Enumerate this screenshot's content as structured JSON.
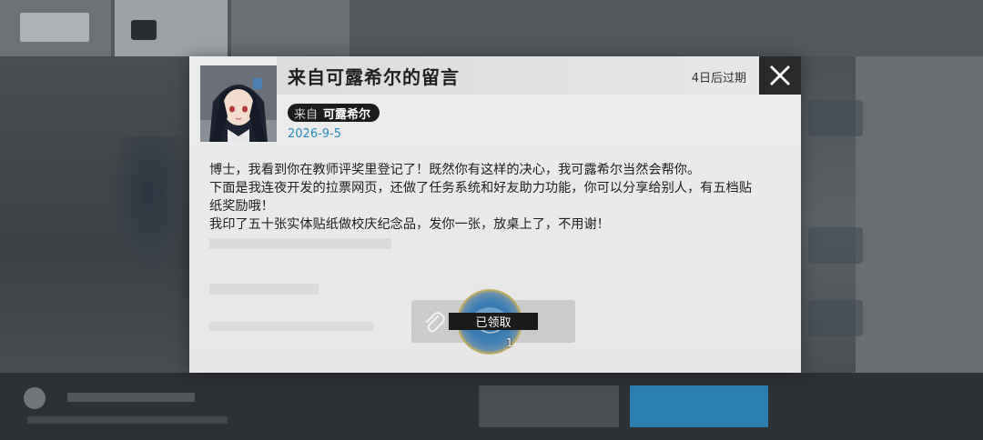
{
  "mail": {
    "title": "来自可露希尔的留言",
    "expiry": "4日后过期",
    "sender_prefix": "来自",
    "sender_name": "可露希尔",
    "date": "2026-9-5",
    "body": [
      "博士，我看到你在教师评奖里登记了！既然你有这样的决心，我可露希尔当然会帮你。",
      "下面是我连夜开发的拉票网页，还做了任务系统和好友助力功能，你可以分享给别人，有五档贴纸奖励哦！",
      "我印了五十张实体贴纸做校庆纪念品，发你一张，放桌上了，不用谢！"
    ]
  },
  "attachment": {
    "status_label": "已领取",
    "count": "1"
  },
  "icons": {
    "close": "close-icon",
    "clip": "paperclip-icon",
    "item": "sticker-item-icon",
    "avatar": "sender-avatar"
  },
  "colors": {
    "accent_date": "#2a8cc6",
    "close_bg": "#2a2a2a",
    "badge_bg": "#1c1c1c",
    "item_ring": "#d6c06a"
  }
}
